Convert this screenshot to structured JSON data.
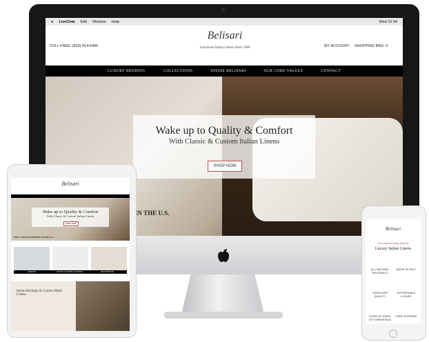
{
  "menubar": {
    "apple": "",
    "app": "LiveChat",
    "items": [
      "Edit",
      "Window",
      "Help"
    ],
    "clock": "Wed 15:34"
  },
  "site": {
    "toll_free": "TOLL FREE: (833) 814-6456",
    "logo": "Belisari",
    "tagline": "Luxurious Italian Linens Since 1980",
    "account": "MY ACCOUNT",
    "bag": "SHOPPING BAG: 0",
    "nav": [
      "LUXURY BEDDING",
      "COLLECTIONS",
      "INSIDE BELISARI",
      "OUR CORE VALUES",
      "CONTACT"
    ],
    "hero_title": "Wake up to Quality & Comfort",
    "hero_subtitle": "With Classic & Custom Italian Linens",
    "hero_button": "SHOP NOW",
    "hero_fragment": "IN THE U.S."
  },
  "tablet": {
    "logo": "Belisari",
    "hero_title": "Wake up to Quality & Comfort",
    "hero_subtitle": "With Classic & Custom Italian Linens",
    "button": "SHOP NOW",
    "banner": "FREE GROUND SHIPPING IN THE U.S.",
    "tiles": [
      "SHEETS",
      "DUVET COVERS & SHAMS",
      "DECORATIVE"
    ],
    "section": "Italian Heritage & Custom Made Linens"
  },
  "phone": {
    "logo": "Belisari",
    "kicker": "Uncompromising Quality",
    "heading": "Luxury Italian Linens",
    "features": [
      "ALL NATURAL MATERIALS",
      "MADE IN ITALY",
      "HEIRLOOM QUALITY",
      "AFFORDABLE LUXURY",
      "OVER 40 YEARS OF EXPERIENCE",
      "FREE SHIPPING"
    ]
  }
}
